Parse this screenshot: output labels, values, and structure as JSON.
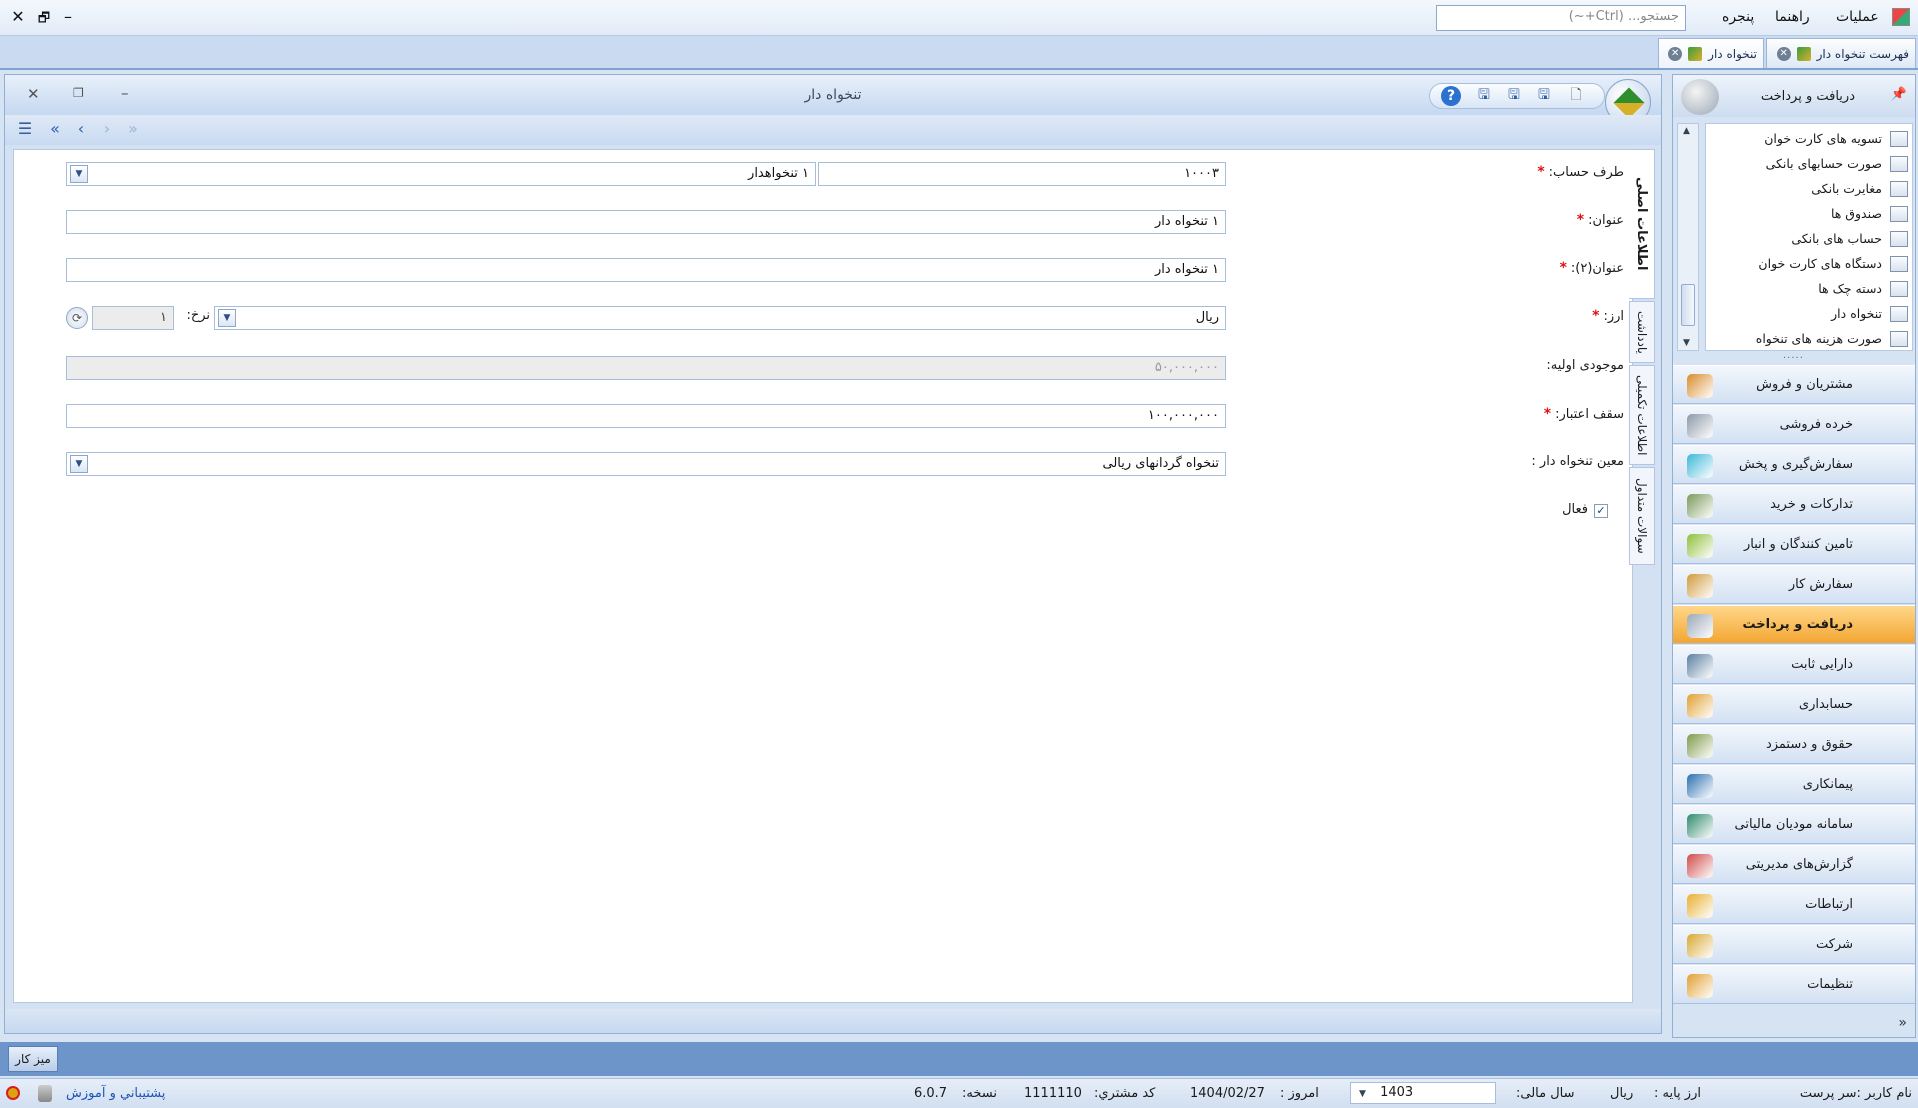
{
  "menubar": {
    "items": [
      "عملیات",
      "راهنما",
      "پنجره"
    ],
    "search_placeholder": "جستجو... (Ctrl+~)"
  },
  "tabs": [
    {
      "label": "فهرست تنخواه دار"
    },
    {
      "label": "تنخواه دار"
    }
  ],
  "form": {
    "title": "تنخواه دار",
    "side_tabs": [
      "اطلاعات اصلی",
      "یادداشت",
      "اطلاعات تکمیلی",
      "سوالات متداول"
    ],
    "fields": {
      "counterparty_label": "طرف حساب:",
      "counterparty_code": "۱۰۰۰۳",
      "counterparty_name": "۱ تنخواهدار",
      "title_label": "عنوان:",
      "title_value": "۱ تنخواه دار",
      "title2_label": "عنوان(۲):",
      "title2_value": "۱ تنخواه دار",
      "currency_label": "ارز:",
      "currency_value": "ریال",
      "rate_label": "نرخ:",
      "rate_value": "۱",
      "opening_balance_label": "موجودی اولیه:",
      "opening_balance_value": "۵۰,۰۰۰,۰۰۰",
      "credit_limit_label": "سقف اعتبار:",
      "credit_limit_value": "۱۰۰,۰۰۰,۰۰۰",
      "account_label": "معین تنخواه دار :",
      "account_value": "تنخواه گردانهای ریالی",
      "active_label": "فعال",
      "active_checked": true
    }
  },
  "navpane": {
    "header": "دریافت و پرداخت",
    "sub_items": [
      "تسویه های کارت خوان",
      "صورت حسابهای بانکی",
      "مغایرت بانکی",
      "صندوق ها",
      "حساب های بانکی",
      "دستگاه های کارت خوان",
      "دسته چک ها",
      "تنخواه دار",
      "صورت هزینه های تنخواه"
    ],
    "modules": [
      {
        "label": "مشتریان و فروش",
        "color": "#d98b2a",
        "active": false
      },
      {
        "label": "خرده فروشی",
        "color": "#8c98a8",
        "active": false
      },
      {
        "label": "سفارش‌گیری و پخش",
        "color": "#3bb8d8",
        "active": false
      },
      {
        "label": "تدارکات و خرید",
        "color": "#7a9a5a",
        "active": false
      },
      {
        "label": "تامین کنندگان و انبار",
        "color": "#8fbf3a",
        "active": false
      },
      {
        "label": "سفارش کار",
        "color": "#d09a3a",
        "active": false
      },
      {
        "label": "دریافت و پرداخت",
        "color": "#9aa8b6",
        "active": true
      },
      {
        "label": "دارایی ثابت",
        "color": "#5a7fa0",
        "active": false
      },
      {
        "label": "حسابداری",
        "color": "#e0a030",
        "active": false
      },
      {
        "label": "حقوق و دستمزد",
        "color": "#7f9a4a",
        "active": false
      },
      {
        "label": "پیمانکاری",
        "color": "#2a6fb0",
        "active": false
      },
      {
        "label": "سامانه مودیان مالیاتی",
        "color": "#2e8a6a",
        "active": false
      },
      {
        "label": "گزارش‌های مدیریتی",
        "color": "#d04a4a",
        "active": false
      },
      {
        "label": "ارتباطات",
        "color": "#e8b030",
        "active": false
      },
      {
        "label": "شرکت",
        "color": "#d8a830",
        "active": false
      },
      {
        "label": "تنظیمات",
        "color": "#e0a030",
        "active": false
      }
    ]
  },
  "taskbar": {
    "desk_label": "میز کار"
  },
  "statusbar": {
    "user": "نام کاربر :سر پرست",
    "base_currency": "ارز پایه :",
    "base_currency_value": "ریال",
    "fiscal_year_label": "سال مالی:",
    "fiscal_year": "1403",
    "today_label": "امروز :",
    "today": "1404/02/27",
    "customer_code_label": "کد مشتري:",
    "customer_code": "1111110",
    "version_label": "نسخه:",
    "version": "6.0.7",
    "support": "پشتيباني و آموزش"
  }
}
